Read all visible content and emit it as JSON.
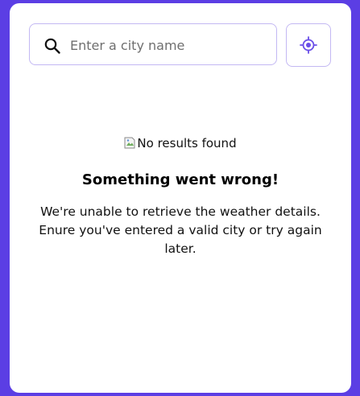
{
  "search": {
    "placeholder": "Enter a city name",
    "value": ""
  },
  "icons": {
    "search": "search-icon",
    "location": "location-crosshair-icon",
    "broken_image": "broken-image-icon"
  },
  "colors": {
    "background": "#5b3ee4",
    "card": "#ffffff",
    "border": "#c3b8f3",
    "accent": "#6a4ee8"
  },
  "error": {
    "image_alt": "No results found",
    "title": "Something went wrong!",
    "message": "We're unable to retrieve the weather details. Enure you've entered a valid city or try again later."
  }
}
